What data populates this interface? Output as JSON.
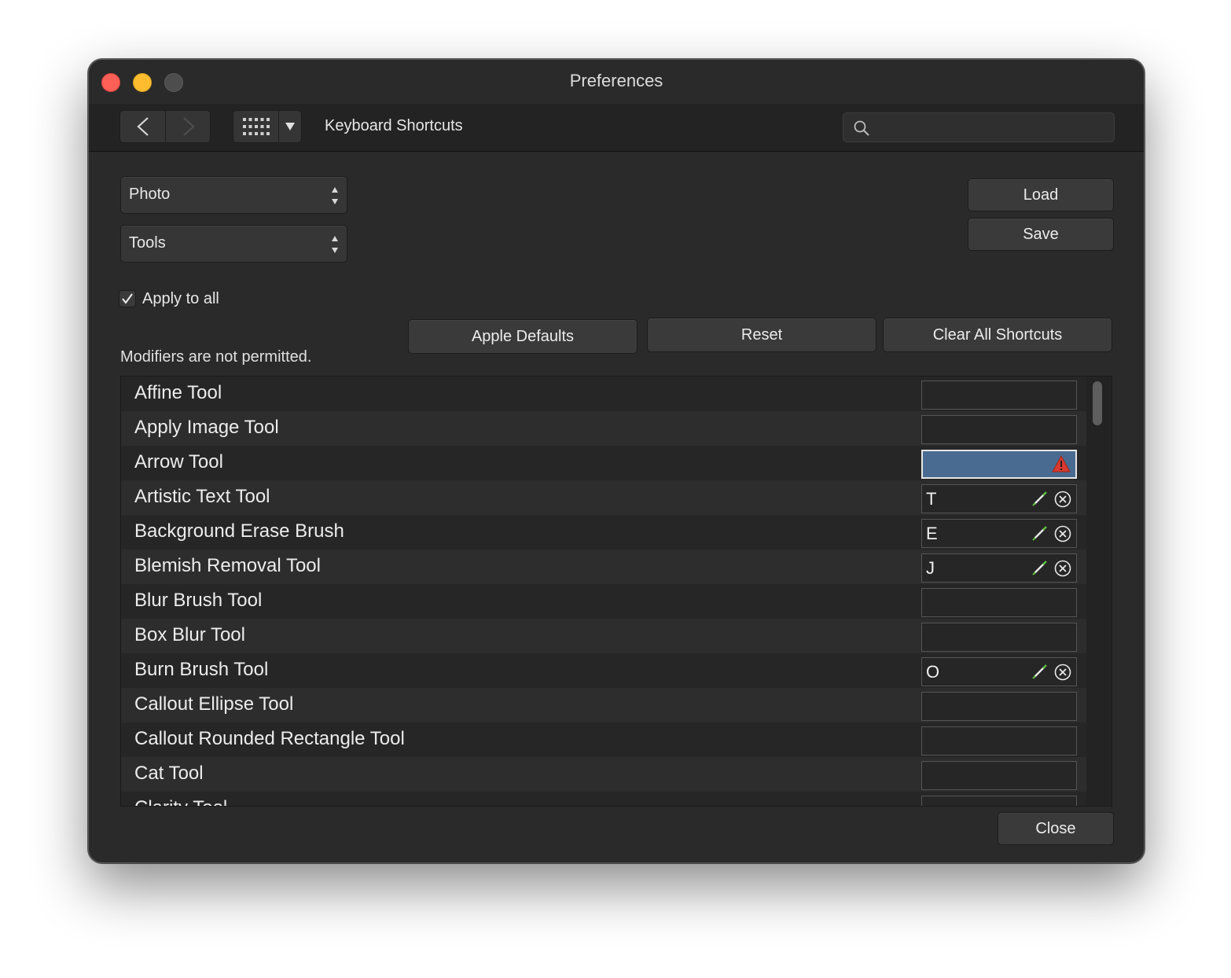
{
  "window": {
    "title": "Preferences"
  },
  "toolbar": {
    "section_title": "Keyboard Shortcuts",
    "back_icon": "chevron-left-icon",
    "forward_icon": "chevron-right-icon",
    "grid_icon": "grid-icon",
    "dropdown_icon": "triangle-down-icon",
    "search": {
      "value": "",
      "placeholder": "",
      "icon": "search-icon"
    }
  },
  "selectors": {
    "app": "Photo",
    "category": "Tools"
  },
  "buttons": {
    "load": "Load",
    "save": "Save",
    "apple_defaults": "Apple Defaults",
    "reset": "Reset",
    "clear_all": "Clear All Shortcuts",
    "close": "Close"
  },
  "apply_to_all": {
    "label": "Apply to all",
    "checked": true
  },
  "note": "Modifiers are not permitted.",
  "shortcuts": [
    {
      "name": "Affine Tool",
      "key": ""
    },
    {
      "name": "Apply Image Tool",
      "key": ""
    },
    {
      "name": "Arrow Tool",
      "key": "",
      "state": "conflict-warning"
    },
    {
      "name": "Artistic Text Tool",
      "key": "T"
    },
    {
      "name": "Background Erase Brush",
      "key": "E"
    },
    {
      "name": "Blemish Removal Tool",
      "key": "J"
    },
    {
      "name": "Blur Brush Tool",
      "key": ""
    },
    {
      "name": "Box Blur Tool",
      "key": ""
    },
    {
      "name": "Burn Brush Tool",
      "key": "O"
    },
    {
      "name": "Callout Ellipse Tool",
      "key": ""
    },
    {
      "name": "Callout Rounded Rectangle Tool",
      "key": ""
    },
    {
      "name": "Cat Tool",
      "key": ""
    },
    {
      "name": "Clarity Tool",
      "key": ""
    }
  ],
  "colors": {
    "window_bg": "#2a2a2a",
    "active_field": "#4a6b91",
    "warning": "#d93a2f",
    "edit_icon": "#5fbf3f"
  }
}
